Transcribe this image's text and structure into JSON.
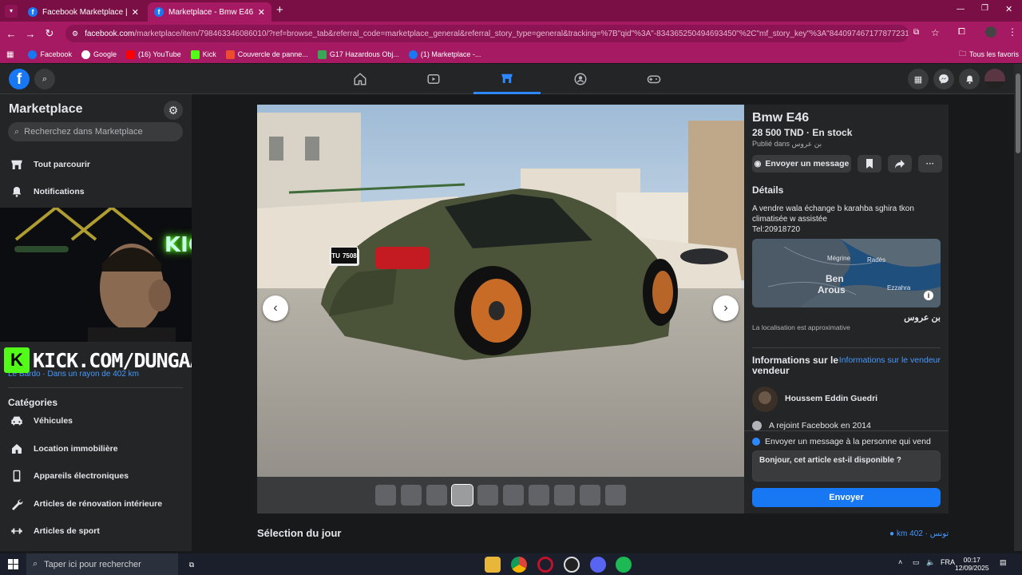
{
  "browser": {
    "tabs": [
      {
        "title": "Facebook Marketplace | Facebook",
        "active": false
      },
      {
        "title": "Marketplace - Bmw E46 | Facebook",
        "active": true
      }
    ],
    "new_tab": "+",
    "url_domain": "facebook.com",
    "url_path": "/marketplace/item/798463346086010/?ref=browse_tab&referral_code=marketplace_general&referral_story_type=general&tracking=%7B\"qid\"%3A\"-834365250494693450\"%2C\"mf_story_key\"%3A\"8440974671778772319\"%2C\"top_lev...",
    "bookmarks": [
      {
        "label": "Facebook",
        "color": "#1877f2"
      },
      {
        "label": "Google",
        "color": "#ffffff"
      },
      {
        "label": "(16) YouTube",
        "color": "#ff0000"
      },
      {
        "label": "Kick",
        "color": "#53fc18"
      },
      {
        "label": "Couvercle de panne...",
        "color": "#ee4d2d"
      },
      {
        "label": "G17 Hazardous Obj...",
        "color": "#3aa757"
      },
      {
        "label": "(1) Marketplace -...",
        "color": "#1877f2"
      }
    ],
    "all_bookmarks": "Tous les favoris"
  },
  "sidebar": {
    "title": "Marketplace",
    "search_placeholder": "Recherchez dans Marketplace",
    "nav": [
      {
        "label": "Tout parcourir",
        "icon": "store-icon"
      },
      {
        "label": "Notifications",
        "icon": "bell-icon"
      }
    ],
    "location": "Le Bardo · Dans un rayon de 402 km",
    "categories_title": "Catégories",
    "categories": [
      {
        "label": "Véhicules",
        "icon": "car-icon"
      },
      {
        "label": "Location immobilière",
        "icon": "house-icon"
      },
      {
        "label": "Appareils électroniques",
        "icon": "phone-icon"
      },
      {
        "label": "Articles de rénovation intérieure",
        "icon": "wrench-icon"
      },
      {
        "label": "Articles de sport",
        "icon": "sport-icon"
      }
    ]
  },
  "overlay": {
    "kick_logo": "K",
    "kick_text": "KICK.COM/DUNGAA",
    "neon_text": "KICK"
  },
  "listing": {
    "title": "Bmw E46",
    "price": "28 500 TND · En stock",
    "published": "Publié dans بن عروس",
    "message_button": "Envoyer un message",
    "details_title": "Détails",
    "description_lines": [
      "A vendre wala échange b karahba sghira tkon",
      "climatisée w assistée",
      "Tel:20918720"
    ],
    "map_labels": {
      "big": "Ben",
      "big2": "Arous",
      "small1": "Mégrine",
      "small2": "Radès",
      "small3": "Ezzahra"
    },
    "city": "بن عروس",
    "approx": "La localisation est approximative",
    "seller_info_title": "Informations sur le vendeur",
    "seller_info_link": "Informations sur le vendeur",
    "seller_name": "Houssem Eddin Guedri",
    "joined": "A rejoint Facebook en 2014",
    "message_box_title": "Envoyer un message à la personne qui vend",
    "message_text": "Bonjour, cet article est-il disponible ?",
    "send_button": "Envoyer",
    "plate_left": "TU",
    "plate_right": "7508"
  },
  "selection": {
    "title": "Sélection du jour",
    "location": "km 402 · تونس"
  },
  "photo": {
    "thumbnail_count": 10,
    "selected_thumbnail": 4
  },
  "taskbar": {
    "search_placeholder": "Taper ici pour rechercher",
    "lang": "FRA",
    "time": "00:17",
    "date": "12/09/2025"
  }
}
